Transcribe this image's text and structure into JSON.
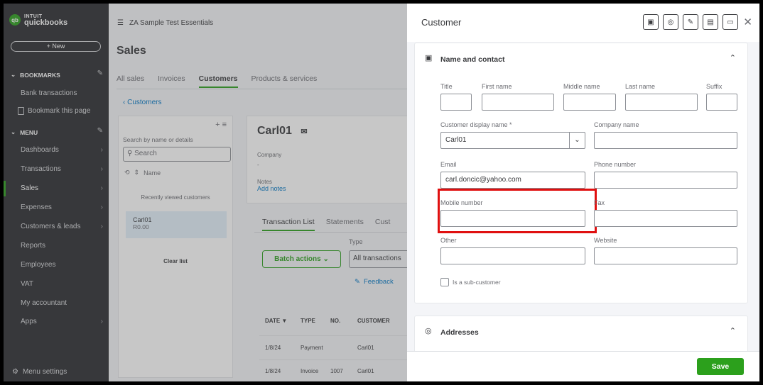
{
  "sidebar": {
    "logo_brand": "INTUIT",
    "logo_product": "quickbooks",
    "new_label": "+ New",
    "bookmarks_label": "BOOKMARKS",
    "bookmark_item": "Bank transactions",
    "bookmark_this_page": "Bookmark this page",
    "menu_label": "MENU",
    "items": [
      {
        "label": "Dashboards",
        "arrow": true
      },
      {
        "label": "Transactions",
        "arrow": true
      },
      {
        "label": "Sales",
        "arrow": true,
        "active": true
      },
      {
        "label": "Expenses",
        "arrow": true
      },
      {
        "label": "Customers & leads",
        "arrow": true
      },
      {
        "label": "Reports",
        "arrow": false
      },
      {
        "label": "Employees",
        "arrow": false
      },
      {
        "label": "VAT",
        "arrow": false
      },
      {
        "label": "My accountant",
        "arrow": false
      },
      {
        "label": "Apps",
        "arrow": true
      }
    ],
    "menu_settings": "Menu settings"
  },
  "main": {
    "company": "ZA Sample Test Essentials",
    "page_title": "Sales",
    "tabs": [
      "All sales",
      "Invoices",
      "Customers",
      "Products & services"
    ],
    "active_tab": "Customers",
    "back_link": "Customers",
    "list": {
      "search_label": "Search by name or details",
      "search_placeholder": "Search",
      "sort_label": "Name",
      "recent_label": "Recently viewed customers",
      "item_name": "Carl01",
      "item_amount": "R0.00",
      "clear_label": "Clear list"
    },
    "detail": {
      "name": "Carl01",
      "company_label": "Company",
      "company_value": "-",
      "notes_label": "Notes",
      "add_notes": "Add notes"
    },
    "tx_tabs": [
      "Transaction List",
      "Statements",
      "Cust"
    ],
    "batch_label": "Batch actions",
    "type_label": "Type",
    "type_value": "All transactions",
    "feedback": "Feedback",
    "table": {
      "headers": [
        "DATE ▼",
        "TYPE",
        "NO.",
        "CUSTOMER"
      ],
      "rows": [
        [
          "1/8/24",
          "Payment",
          "",
          "Carl01"
        ],
        [
          "1/8/24",
          "Invoice",
          "1007",
          "Carl01"
        ]
      ]
    }
  },
  "panel": {
    "title": "Customer",
    "section1_title": "Name and contact",
    "labels": {
      "title": "Title",
      "first": "First name",
      "middle": "Middle name",
      "last": "Last name",
      "suffix": "Suffix",
      "display": "Customer display name *",
      "company": "Company name",
      "email": "Email",
      "phone": "Phone number",
      "mobile": "Mobile number",
      "fax": "Fax",
      "other": "Other",
      "website": "Website",
      "subcustomer": "Is a sub-customer"
    },
    "values": {
      "display": "Carl01",
      "email": "carl.doncic@yahoo.com"
    },
    "section2_title": "Addresses",
    "save_label": "Save",
    "colors": {
      "accent": "#2ca01c",
      "highlight": "#e01010"
    }
  }
}
